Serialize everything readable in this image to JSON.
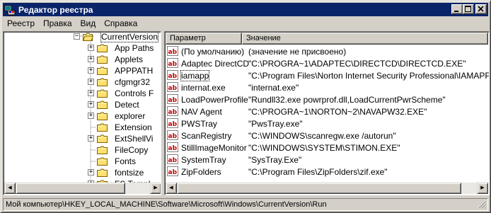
{
  "window": {
    "title": "Редактор реестра",
    "colors": {
      "titlebar": "#0a246a",
      "face": "#d4d0c8"
    }
  },
  "menu": [
    {
      "label": "Реестр"
    },
    {
      "label": "Правка"
    },
    {
      "label": "Вид"
    },
    {
      "label": "Справка"
    }
  ],
  "tree": [
    {
      "label": "CurrentVersion",
      "expander": "minus",
      "icon": "open-folder"
    },
    {
      "label": "App Paths",
      "expander": "plus",
      "icon": "folder"
    },
    {
      "label": "Applets",
      "expander": "plus",
      "icon": "folder"
    },
    {
      "label": "APPPATH",
      "expander": "plus",
      "icon": "folder"
    },
    {
      "label": "cfgmgr32",
      "expander": "plus",
      "icon": "folder"
    },
    {
      "label": "Controls F",
      "expander": "plus",
      "icon": "folder"
    },
    {
      "label": "Detect",
      "expander": "plus",
      "icon": "folder"
    },
    {
      "label": "explorer",
      "expander": "plus",
      "icon": "folder"
    },
    {
      "label": "Extension",
      "expander": "",
      "icon": "folder"
    },
    {
      "label": "ExtShellVi",
      "expander": "plus",
      "icon": "folder"
    },
    {
      "label": "FileCopy",
      "expander": "",
      "icon": "folder"
    },
    {
      "label": "Fonts",
      "expander": "",
      "icon": "folder"
    },
    {
      "label": "fontsize",
      "expander": "plus",
      "icon": "folder"
    },
    {
      "label": "FS Templ",
      "expander": "plus",
      "icon": "folder"
    }
  ],
  "columns": {
    "name": "Параметр",
    "data": "Значение"
  },
  "values": [
    {
      "name": "(По умолчанию)",
      "data": "(значение не присвоено)"
    },
    {
      "name": "Adaptec DirectCD",
      "data": "\"C:\\PROGRA~1\\ADAPTEC\\DIRECTCD\\DIRECTCD.EXE\""
    },
    {
      "name": "iamapp",
      "data": "\"C:\\Program Files\\Norton Internet Security Professional\\IAMAPP.EXE\""
    },
    {
      "name": "internat.exe",
      "data": "\"internat.exe\""
    },
    {
      "name": "LoadPowerProfile",
      "data": "\"Rundll32.exe powrprof.dll,LoadCurrentPwrScheme\""
    },
    {
      "name": "NAV Agent",
      "data": "\"C:\\PROGRA~1\\NORTON~2\\NAVAPW32.EXE\""
    },
    {
      "name": "PWSTray",
      "data": "\"PwsTray.exe\""
    },
    {
      "name": "ScanRegistry",
      "data": "\"C:\\WINDOWS\\scanregw.exe /autorun\""
    },
    {
      "name": "StillImageMonitor",
      "data": "\"C:\\WINDOWS\\SYSTEM\\STIMON.EXE\""
    },
    {
      "name": "SystemTray",
      "data": "\"SysTray.Exe\""
    },
    {
      "name": "ZipFolders",
      "data": "\"C:\\Program Files\\ZipFolders\\zif.exe\""
    }
  ],
  "status": {
    "path": "Мой компьютер\\HKEY_LOCAL_MACHINE\\Software\\Microsoft\\Windows\\CurrentVersion\\Run"
  }
}
